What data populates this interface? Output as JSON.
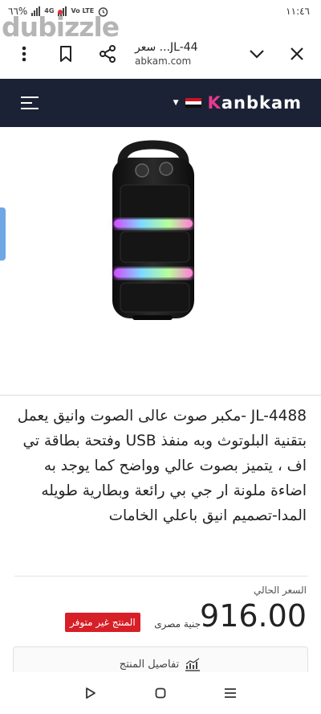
{
  "status": {
    "time": "١١:٤٦",
    "battery": "٦٦%",
    "network_4g": "4G",
    "volte": "Vo LTE"
  },
  "watermark": {
    "text": "dubizzle"
  },
  "browser": {
    "title": "سعر ...JL-44",
    "url": "abkam.com"
  },
  "site": {
    "logo_left": "K",
    "logo_text": "anbkam"
  },
  "product": {
    "description": "JL-4488 -مكبر صوت عالى الصوت وانيق يعمل بتقنية البلوتوث وبه منفذ USB وفتحة بطاقة تي اف ، يتميز بصوت عالي وواضح كما يوجد به اضاءة ملونة ار جي بي رائعة وبطارية طويله المدا-تصميم انيق باعلي الخامات",
    "price_label": "السعر الحالي",
    "price": "916.00",
    "currency": "جنية مصرى",
    "stock_status": "المنتج غير متوفر",
    "details_label": "تفاصيل المنتج"
  },
  "colors": {
    "header_bg": "#1c2235",
    "brand_pink": "#e83a8e",
    "badge_red": "#d71f27",
    "led_glow": "#7fd9ff"
  }
}
